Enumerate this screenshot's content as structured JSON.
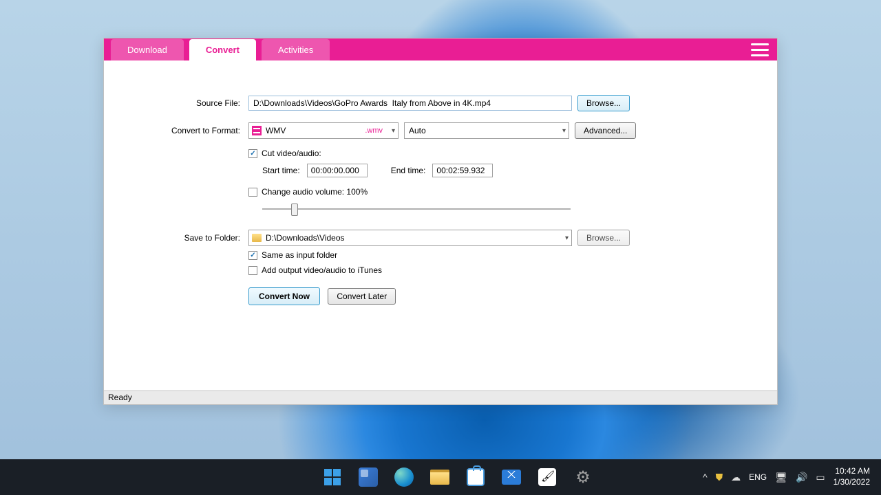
{
  "tabs": {
    "download": "Download",
    "convert": "Convert",
    "activities": "Activities"
  },
  "labels": {
    "source_file": "Source File:",
    "convert_to": "Convert to Format:",
    "save_to": "Save to Folder:",
    "start_time": "Start time:",
    "end_time": "End time:"
  },
  "values": {
    "source_path": "D:\\Downloads\\Videos\\GoPro Awards  Italy from Above in 4K.mp4",
    "format_name": "WMV",
    "format_ext": ".wmv",
    "quality": "Auto",
    "start_time": "00:00:00.000",
    "end_time": "00:02:59.932",
    "output_folder": "D:\\Downloads\\Videos"
  },
  "checkboxes": {
    "cut": "Cut video/audio:",
    "volume": "Change audio volume: 100%",
    "same_folder": "Same as input folder",
    "itunes": "Add output video/audio to iTunes"
  },
  "buttons": {
    "browse": "Browse...",
    "advanced": "Advanced...",
    "convert_now": "Convert Now",
    "convert_later": "Convert Later"
  },
  "status": "Ready",
  "taskbar": {
    "lang": "ENG",
    "time": "10:42 AM",
    "date": "1/30/2022"
  }
}
